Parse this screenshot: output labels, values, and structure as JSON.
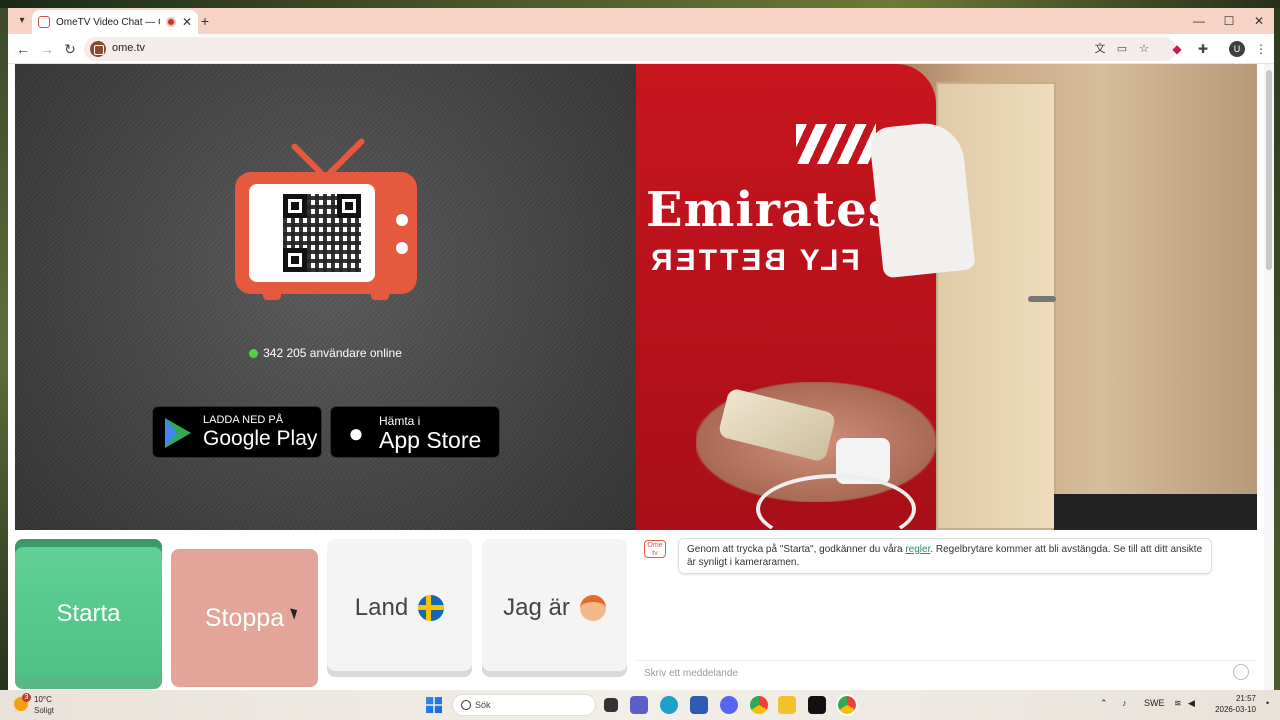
{
  "browser": {
    "tab_title": "OmeTV Video Chat — Ome",
    "tab_close": "✕",
    "new_tab": "+",
    "url": "ome.tv",
    "profile_initial": "U",
    "window_controls": [
      "—",
      "☐",
      "✕"
    ]
  },
  "left_panel": {
    "online_count": "342 205 användare online",
    "google_play": {
      "line1": "LADDA NED PÅ",
      "line2": "Google Play"
    },
    "app_store": {
      "line1": "Hämta i",
      "line2": "App Store"
    }
  },
  "remote_video": {
    "shirt_sponsor": "Emirates",
    "shirt_slogan": "FLY BETTER"
  },
  "controls": {
    "start": "Starta",
    "stop": "Stoppa",
    "country": "Land",
    "i_am": "Jag är"
  },
  "chat": {
    "badge": "Ome tv",
    "notice_before": "Genom att trycka på \"Starta\", godkänner du våra ",
    "notice_link": "regler",
    "notice_after": ". Regelbrytare kommer att bli avstängda. Se till att ditt ansikte är synligt i kameraramen.",
    "input_placeholder": "Skriv ett meddelande"
  },
  "taskbar": {
    "weather_badge": "3",
    "weather_temp": "10°C",
    "weather_condition": "Soligt",
    "search_label": "Sök",
    "language": "SWE",
    "time": "21:57",
    "date": "2026-03-10"
  },
  "colors": {
    "accent": "#e5593f",
    "start": "#5ccb8f",
    "stop": "#e3a59a",
    "online_dot": "#4bd442",
    "tab_bar": "#f7d3c6"
  }
}
